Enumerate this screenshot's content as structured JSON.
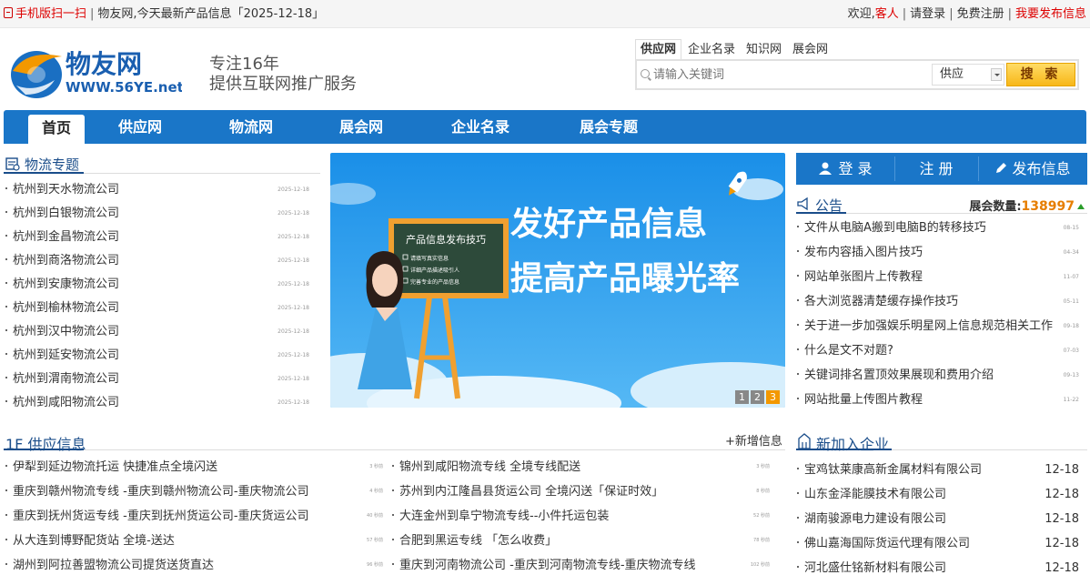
{
  "topbar": {
    "mobile_scan": "手机版扫一扫",
    "site_name": "物友网",
    "today_info": "今天最新产品信息「2025-12-18」",
    "welcome": "欢迎,",
    "guest": "客人",
    "login": "请登录",
    "register": "免费注册",
    "publish": "我要发布信息"
  },
  "logo": {
    "brand": "物友网",
    "url": "WWW.56YE.net"
  },
  "slogan": {
    "line1": "专注16年",
    "line2": "提供互联网推广服务"
  },
  "search": {
    "tabs": [
      "供应网",
      "企业名录",
      "知识网",
      "展会网"
    ],
    "placeholder": "请输入关键词",
    "select_value": "供应",
    "button": "搜 索"
  },
  "nav": {
    "items": [
      "首页",
      "供应网",
      "物流网",
      "展会网",
      "企业名录",
      "展会专题"
    ]
  },
  "logistics": {
    "title": "物流专题",
    "items": [
      {
        "title": "杭州到天水物流公司",
        "date": "2025-12-18"
      },
      {
        "title": "杭州到白银物流公司",
        "date": "2025-12-18"
      },
      {
        "title": "杭州到金昌物流公司",
        "date": "2025-12-18"
      },
      {
        "title": "杭州到商洛物流公司",
        "date": "2025-12-18"
      },
      {
        "title": "杭州到安康物流公司",
        "date": "2025-12-18"
      },
      {
        "title": "杭州到榆林物流公司",
        "date": "2025-12-18"
      },
      {
        "title": "杭州到汉中物流公司",
        "date": "2025-12-18"
      },
      {
        "title": "杭州到延安物流公司",
        "date": "2025-12-18"
      },
      {
        "title": "杭州到渭南物流公司",
        "date": "2025-12-18"
      },
      {
        "title": "杭州到咸阳物流公司",
        "date": "2025-12-18"
      }
    ]
  },
  "banner": {
    "board_title": "产品信息发布技巧",
    "board_lines": [
      "请填写真实信息",
      "详细产品描述吸引人",
      "完善专业的产品信息"
    ],
    "headline1": "发好产品信息",
    "headline2": "提高产品曝光率",
    "pager": [
      "1",
      "2",
      "3"
    ]
  },
  "actions": {
    "login": "登 录",
    "register": "注 册",
    "publish": "发布信息"
  },
  "notice": {
    "title": "公告",
    "expo_label": "展会数量:",
    "expo_count": "138997",
    "items": [
      {
        "title": "文件从电脑A搬到电脑B的转移技巧",
        "date": "08-15"
      },
      {
        "title": "发布内容插入图片技巧",
        "date": "04-34"
      },
      {
        "title": "网站单张图片上传教程",
        "date": "11-07"
      },
      {
        "title": "各大浏览器清楚缓存操作技巧",
        "date": "05-11"
      },
      {
        "title": "关于进一步加强娱乐明星网上信息规范相关工作",
        "date": "09-18"
      },
      {
        "title": "什么是文不对题?",
        "date": "07-03"
      },
      {
        "title": "关键词排名置顶效果展现和费用介绍",
        "date": "09-13"
      },
      {
        "title": "网站批量上传图片教程",
        "date": "11-22"
      }
    ]
  },
  "supply": {
    "title": "1F 供应信息",
    "add_label": "+新增信息",
    "left": [
      {
        "title": "伊犁到延边物流托运 快捷准点全境闪送",
        "time": "3 秒前"
      },
      {
        "title": "重庆到赣州物流专线 -重庆到赣州物流公司-重庆物流公司",
        "time": "4 秒前"
      },
      {
        "title": "重庆到抚州货运专线 -重庆到抚州货运公司-重庆货运公司",
        "time": "40 秒前"
      },
      {
        "title": "从大连到博野配货站 全境-送达",
        "time": "57 秒前"
      },
      {
        "title": "湖州到阿拉善盟物流公司提货送货直达",
        "time": "96 秒前"
      }
    ],
    "right": [
      {
        "title": "锦州到咸阳物流专线 全境专线配送",
        "time": "3 秒前"
      },
      {
        "title": "苏州到内江隆昌县货运公司 全境闪送「保证时效」",
        "time": "8 秒前"
      },
      {
        "title": "大连金州到阜宁物流专线--小件托运包装",
        "time": "52 秒前"
      },
      {
        "title": "合肥到黑运专线 「怎么收费」",
        "time": "78 秒前"
      },
      {
        "title": "重庆到河南物流公司 -重庆到河南物流专线-重庆物流专线",
        "time": "102 秒前"
      }
    ]
  },
  "enterprise": {
    "title": "新加入企业",
    "items": [
      {
        "name": "宝鸡钛莱康高新金属材料有限公司",
        "date": "12-18"
      },
      {
        "name": "山东金泽能膜技术有限公司",
        "date": "12-18"
      },
      {
        "name": "湖南骏源电力建设有限公司",
        "date": "12-18"
      },
      {
        "name": "佛山嘉海国际货运代理有限公司",
        "date": "12-18"
      },
      {
        "name": "河北盛仕铭新材料有限公司",
        "date": "12-18"
      }
    ]
  },
  "colors": {
    "nav_blue": "#1a76c8",
    "accent_red": "#dd0000",
    "expo_orange": "#e67e00",
    "banner_blue": "#1c8ae6"
  }
}
